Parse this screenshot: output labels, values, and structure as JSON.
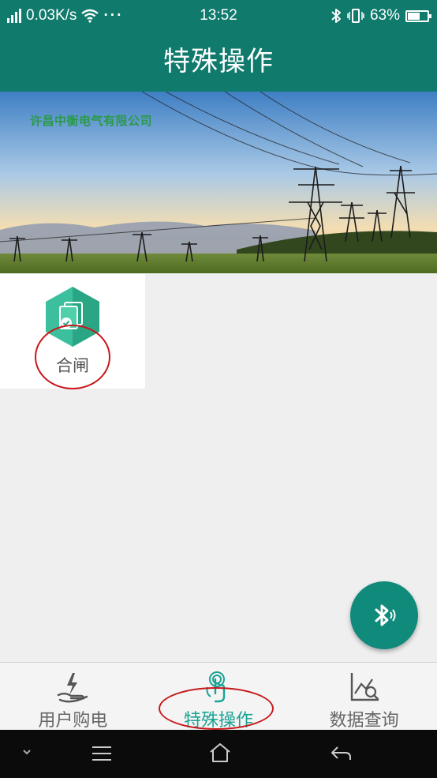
{
  "status": {
    "speed": "0.03K/s",
    "dots": "···",
    "time": "13:52",
    "battery": "63%",
    "battery_level": 0.63
  },
  "app_bar": {
    "title": "特殊操作"
  },
  "banner": {
    "company": "许昌中衡电气有限公司"
  },
  "tiles": [
    {
      "label": "合闸",
      "icon": "switch-close-icon"
    }
  ],
  "fab": {
    "icon": "bluetooth-icon"
  },
  "bottom_nav": [
    {
      "label": "用户购电",
      "icon": "purchase-power-icon"
    },
    {
      "label": "特殊操作",
      "icon": "touch-operation-icon",
      "active": true
    },
    {
      "label": "数据查询",
      "icon": "chart-search-icon"
    }
  ],
  "colors": {
    "primary": "#107a6c",
    "accent": "#19a394",
    "annotation": "#c8181c"
  }
}
